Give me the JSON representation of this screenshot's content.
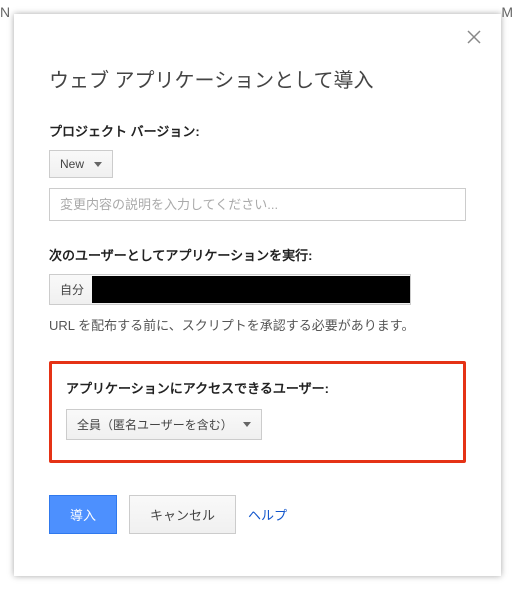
{
  "outer": {
    "left": "N",
    "right": "M"
  },
  "dialog": {
    "title": "ウェブ アプリケーションとして導入",
    "project_version": {
      "label": "プロジェクト バージョン:",
      "selected": "New",
      "description_placeholder": "変更内容の説明を入力してください..."
    },
    "execute_as": {
      "label": "次のユーザーとしてアプリケーションを実行:",
      "selected_prefix": "自分",
      "helper": "URL を配布する前に、スクリプトを承認する必要があります。"
    },
    "access": {
      "label": "アプリケーションにアクセスできるユーザー:",
      "selected": "全員（匿名ユーザーを含む）"
    },
    "buttons": {
      "deploy": "導入",
      "cancel": "キャンセル",
      "help": "ヘルプ"
    }
  }
}
